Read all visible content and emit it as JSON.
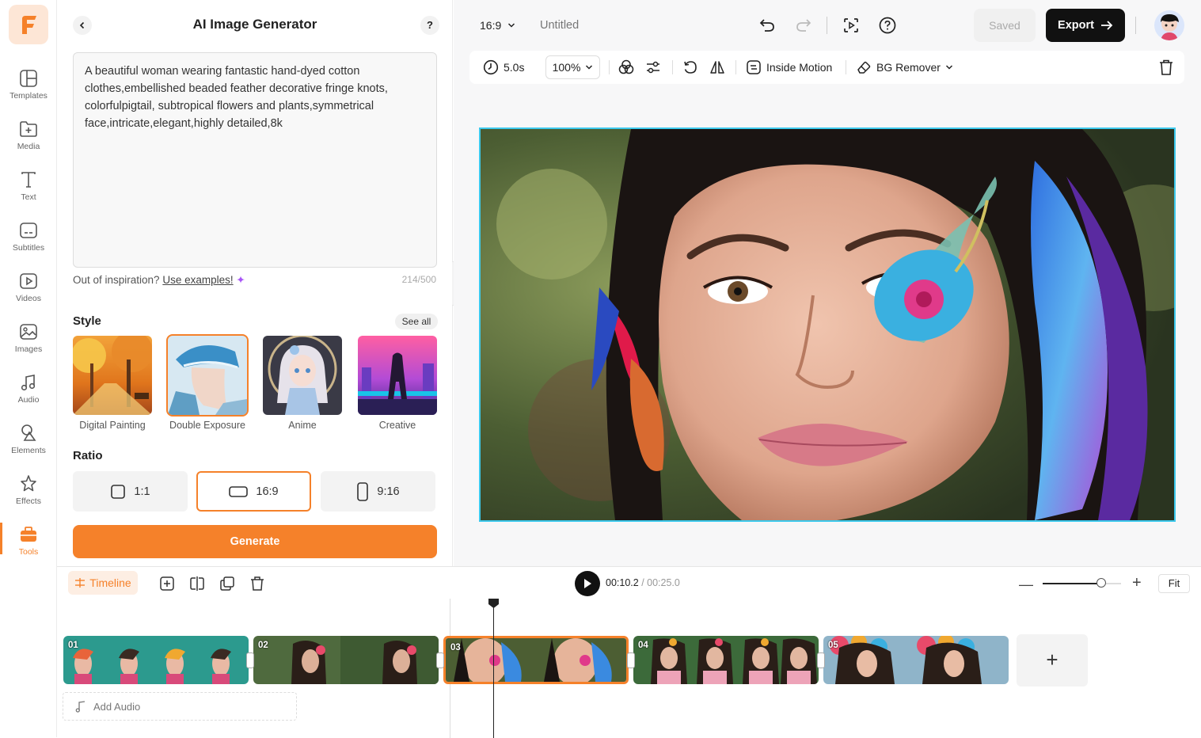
{
  "colors": {
    "accent": "#f5812a",
    "selection": "#3cc9ec",
    "dark": "#111111"
  },
  "sidebar": {
    "items": [
      {
        "label": "Templates",
        "icon": "templates-icon"
      },
      {
        "label": "Media",
        "icon": "media-icon"
      },
      {
        "label": "Text",
        "icon": "text-icon"
      },
      {
        "label": "Subtitles",
        "icon": "subtitles-icon"
      },
      {
        "label": "Videos",
        "icon": "videos-icon"
      },
      {
        "label": "Images",
        "icon": "images-icon"
      },
      {
        "label": "Audio",
        "icon": "audio-icon"
      },
      {
        "label": "Elements",
        "icon": "elements-icon"
      },
      {
        "label": "Effects",
        "icon": "effects-icon"
      },
      {
        "label": "Tools",
        "icon": "tools-icon",
        "active": true
      }
    ]
  },
  "panel": {
    "title": "AI Image Generator",
    "help": "?",
    "prompt": "A beautiful woman wearing fantastic hand-dyed cotton clothes,embellished beaded feather decorative fringe knots, colorfulpigtail, subtropical flowers and plants,symmetrical face,intricate,elegant,highly detailed,8k",
    "inspiration_text": "Out of inspiration?",
    "inspiration_link": "Use examples!",
    "char_count": "214/500",
    "style_title": "Style",
    "see_all": "See all",
    "styles": [
      {
        "label": "Digital Painting"
      },
      {
        "label": "Double Exposure",
        "selected": true
      },
      {
        "label": "Anime"
      },
      {
        "label": "Creative"
      }
    ],
    "ratio_title": "Ratio",
    "ratios": [
      {
        "label": "1:1"
      },
      {
        "label": "16:9",
        "selected": true
      },
      {
        "label": "9:16"
      }
    ],
    "generate_label": "Generate"
  },
  "topbar": {
    "aspect": "16:9",
    "project_name": "Untitled",
    "saved_label": "Saved",
    "export_label": "Export"
  },
  "toolbar": {
    "duration": "5.0s",
    "zoom": "100%",
    "inside_motion": "Inside Motion",
    "bg_remover": "BG Remover"
  },
  "timeline": {
    "tab_label": "Timeline",
    "current_time": "00:10.2",
    "total_time": " / 00:25.0",
    "fit_label": "Fit",
    "zoom_level": 0.75,
    "clips": [
      {
        "num": "01"
      },
      {
        "num": "02"
      },
      {
        "num": "03",
        "selected": true
      },
      {
        "num": "04"
      },
      {
        "num": "05"
      }
    ],
    "add_clip": "+",
    "add_audio": "Add Audio"
  }
}
